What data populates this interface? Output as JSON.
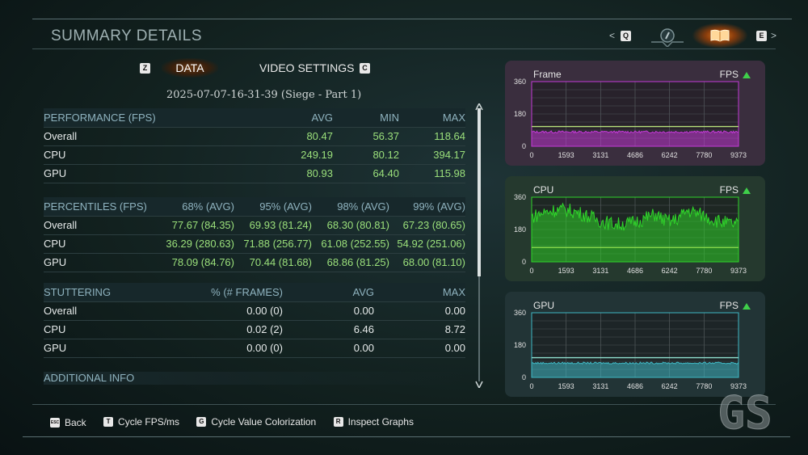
{
  "header": {
    "title": "SUMMARY DETAILS",
    "prev_key": "Q",
    "next_key": "E"
  },
  "tabs": {
    "prev_key": "Z",
    "data_label": "DATA",
    "video_label": "VIDEO SETTINGS",
    "next_key": "C"
  },
  "session": "2025-07-07-16-31-39 (Siege - Part 1)",
  "performance": {
    "headers": [
      "PERFORMANCE (FPS)",
      "AVG",
      "MIN",
      "MAX"
    ],
    "rows": [
      [
        "Overall",
        "80.47",
        "56.37",
        "118.64"
      ],
      [
        "CPU",
        "249.19",
        "80.12",
        "394.17"
      ],
      [
        "GPU",
        "80.93",
        "64.40",
        "115.98"
      ]
    ]
  },
  "percentiles": {
    "headers": [
      "PERCENTILES (FPS)",
      "68% (AVG)",
      "95% (AVG)",
      "98% (AVG)",
      "99% (AVG)"
    ],
    "rows": [
      [
        "Overall",
        "77.67 (84.35)",
        "69.93 (81.24)",
        "68.30 (80.81)",
        "67.23 (80.65)"
      ],
      [
        "CPU",
        "36.29 (280.63)",
        "71.88 (256.77)",
        "61.08 (252.55)",
        "54.92 (251.06)"
      ],
      [
        "GPU",
        "78.09 (84.76)",
        "70.44 (81.68)",
        "68.86 (81.25)",
        "68.00 (81.10)"
      ]
    ]
  },
  "stuttering": {
    "headers": [
      "STUTTERING",
      "% (# FRAMES)",
      "AVG",
      "MAX"
    ],
    "rows": [
      [
        "Overall",
        "0.00 (0)",
        "0.00",
        "0.00"
      ],
      [
        "CPU",
        "0.02 (2)",
        "6.46",
        "8.72"
      ],
      [
        "GPU",
        "0.00 (0)",
        "0.00",
        "0.00"
      ]
    ]
  },
  "additional_info": "ADDITIONAL INFO",
  "graphs": [
    {
      "title": "Frame",
      "unit": "FPS",
      "color": "#c23ad6",
      "bg": "#3a2a3e",
      "line": "#b6e07a",
      "baseline": 80,
      "noise": 6,
      "yticks": [
        "360",
        "180",
        "0"
      ],
      "xticks": [
        "0",
        "1593",
        "3131",
        "4686",
        "6242",
        "7780",
        "9373"
      ]
    },
    {
      "title": "CPU",
      "unit": "FPS",
      "color": "#2fd42a",
      "bg": "#243a2c",
      "line": "#8fe04f",
      "baseline": 250,
      "noise": 40,
      "yticks": [
        "360",
        "180",
        "0"
      ],
      "xticks": [
        "0",
        "1593",
        "3131",
        "4686",
        "6242",
        "7780",
        "9373"
      ]
    },
    {
      "title": "GPU",
      "unit": "FPS",
      "color": "#3fb8c4",
      "bg": "#223436",
      "line": "#8fe0d0",
      "baseline": 80,
      "noise": 5,
      "yticks": [
        "360",
        "180",
        "0"
      ],
      "xticks": [
        "0",
        "1593",
        "3131",
        "4686",
        "6242",
        "7780",
        "9373"
      ]
    }
  ],
  "footer": [
    {
      "key": "ESC",
      "label": "Back"
    },
    {
      "key": "T",
      "label": "Cycle FPS/ms"
    },
    {
      "key": "G",
      "label": "Cycle Value Colorization"
    },
    {
      "key": "R",
      "label": "Inspect Graphs"
    }
  ],
  "watermark": "GS"
}
